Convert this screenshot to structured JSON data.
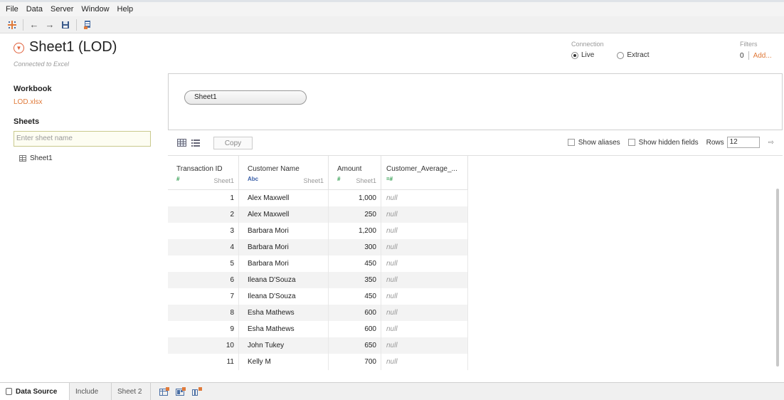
{
  "menu": [
    "File",
    "Data",
    "Server",
    "Window",
    "Help"
  ],
  "toolbar": {
    "icons": [
      "tableau-logo-icon",
      "back-arrow-icon",
      "forward-arrow-icon",
      "save-icon",
      "new-data-source-icon"
    ]
  },
  "header": {
    "title": "Sheet1 (LOD)",
    "connected": "Connected to Excel",
    "connection_label": "Connection",
    "live_label": "Live",
    "extract_label": "Extract",
    "connection_selected": "Live",
    "filters_label": "Filters",
    "filters_count": "0",
    "filters_add": "Add..."
  },
  "sidebar": {
    "workbook_heading": "Workbook",
    "workbook_file": "LOD.xlsx",
    "sheets_heading": "Sheets",
    "search_placeholder": "Enter sheet name",
    "sheets": [
      "Sheet1"
    ]
  },
  "canvas": {
    "table_pill": "Sheet1"
  },
  "grid_toolbar": {
    "copy_label": "Copy",
    "show_aliases": "Show aliases",
    "show_hidden": "Show hidden fields",
    "rows_label": "Rows",
    "rows_value": "12"
  },
  "grid": {
    "columns": [
      {
        "name": "Transaction ID",
        "type": "#",
        "source": "Sheet1"
      },
      {
        "name": "Customer Name",
        "type": "Abc",
        "source": "Sheet1"
      },
      {
        "name": "Amount",
        "type": "#",
        "source": "Sheet1"
      },
      {
        "name": "Customer_Average_...",
        "type": "=#",
        "source": ""
      }
    ],
    "rows": [
      [
        "1",
        "Alex Maxwell",
        "1,000",
        "null"
      ],
      [
        "2",
        "Alex Maxwell",
        "250",
        "null"
      ],
      [
        "3",
        "Barbara Mori",
        "1,200",
        "null"
      ],
      [
        "4",
        "Barbara Mori",
        "300",
        "null"
      ],
      [
        "5",
        "Barbara Mori",
        "450",
        "null"
      ],
      [
        "6",
        "Ileana D'Souza",
        "350",
        "null"
      ],
      [
        "7",
        "Ileana D'Souza",
        "450",
        "null"
      ],
      [
        "8",
        "Esha Mathews",
        "600",
        "null"
      ],
      [
        "9",
        "Esha Mathews",
        "600",
        "null"
      ],
      [
        "10",
        "John Tukey",
        "650",
        "null"
      ],
      [
        "11",
        "Kelly M",
        "700",
        "null"
      ]
    ]
  },
  "bottom_tabs": {
    "data_source": "Data Source",
    "tab2": "Include",
    "tab3": "Sheet 2",
    "icons": [
      "new-worksheet-icon",
      "new-dashboard-icon",
      "new-story-icon"
    ]
  },
  "colors": {
    "accent": "#e07a3a",
    "type_number": "#2a9a4a",
    "type_string": "#3a5fa8"
  }
}
